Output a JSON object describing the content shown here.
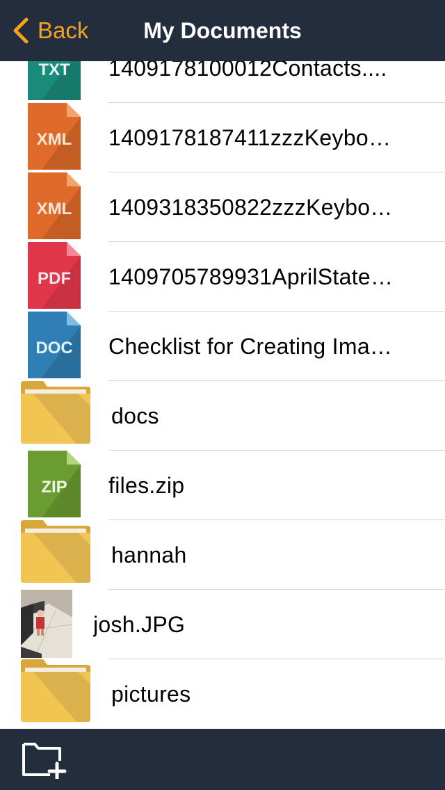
{
  "nav": {
    "back_label": "Back",
    "title": "My Documents"
  },
  "colors": {
    "bar": "#232d3e",
    "accent": "#f7a21b",
    "txt": "#1a8a7a",
    "xml": "#e06a2a",
    "pdf": "#e0364a",
    "doc": "#2f7fb4",
    "zip": "#6a9c32",
    "folder": "#f2c452"
  },
  "files": [
    {
      "name": "1409178100012Contacts....",
      "icon": "txt-file-icon",
      "badge": "TXT"
    },
    {
      "name": "1409178187411zzzKeybo…",
      "icon": "xml-file-icon",
      "badge": "XML"
    },
    {
      "name": "1409318350822zzzKeybo…",
      "icon": "xml-file-icon",
      "badge": "XML"
    },
    {
      "name": "1409705789931AprilState…",
      "icon": "pdf-file-icon",
      "badge": "PDF"
    },
    {
      "name": "Checklist for Creating Ima…",
      "icon": "doc-file-icon",
      "badge": "DOC"
    },
    {
      "name": "docs",
      "icon": "folder-icon"
    },
    {
      "name": "files.zip",
      "icon": "zip-file-icon",
      "badge": "ZIP"
    },
    {
      "name": "hannah",
      "icon": "folder-icon"
    },
    {
      "name": "josh.JPG",
      "icon": "photo-thumbnail"
    },
    {
      "name": "pictures",
      "icon": "folder-icon"
    }
  ],
  "toolbar": {
    "new_folder_icon": "new-folder-icon"
  }
}
